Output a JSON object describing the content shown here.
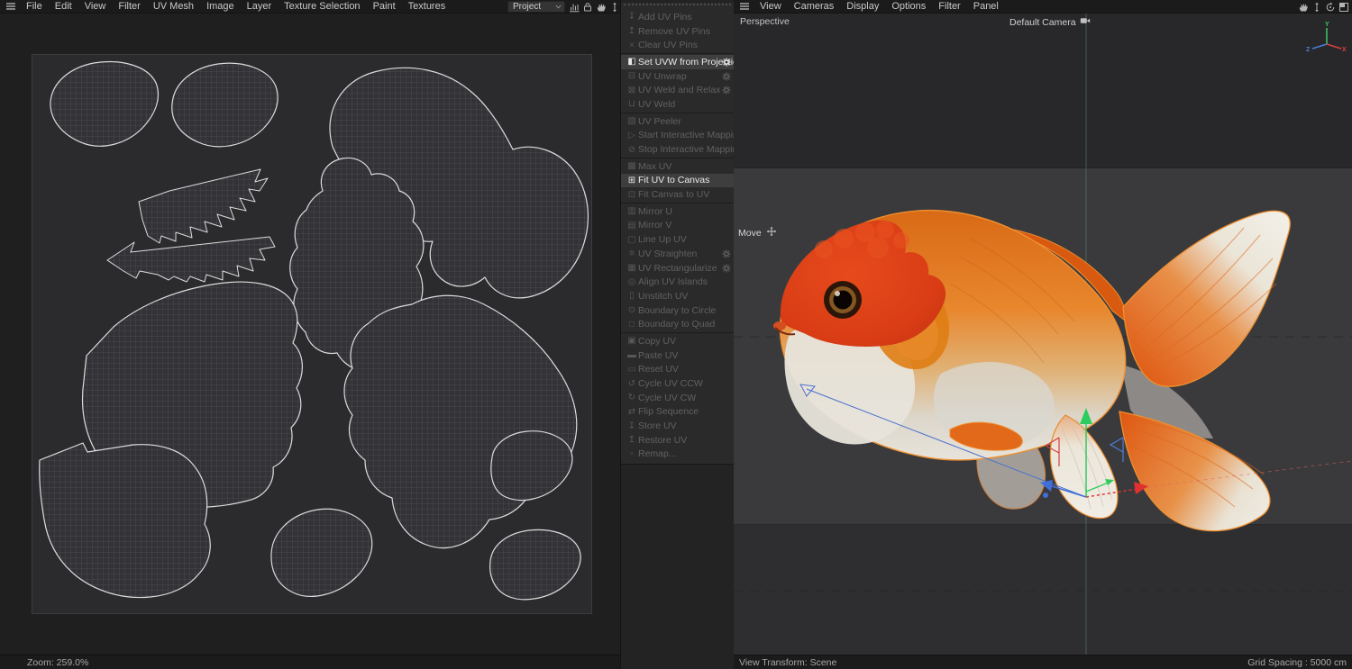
{
  "left_menubar": {
    "menu_items": [
      "File",
      "Edit",
      "View",
      "Filter",
      "UV Mesh",
      "Image",
      "Layer",
      "Texture Selection",
      "Paint",
      "Textures"
    ],
    "project_dropdown": {
      "value": "Project"
    },
    "toolbar_icons": [
      "histogram-icon",
      "lock-icon",
      "hand-icon",
      "pan-vertical-icon"
    ]
  },
  "right_menubar": {
    "menu_items": [
      "View",
      "Cameras",
      "Display",
      "Options",
      "Filter",
      "Panel"
    ],
    "nav_icons": [
      "hand-icon",
      "pan-vertical-icon",
      "rotate-icon",
      "maximize-icon"
    ]
  },
  "uv_panel": {
    "groups": [
      {
        "items": [
          {
            "label": "Add UV Pins",
            "icon": "pin-add-icon",
            "enabled": false
          },
          {
            "label": "Remove UV Pins",
            "icon": "pin-remove-icon",
            "enabled": false
          },
          {
            "label": "Clear UV Pins",
            "icon": "clear-icon",
            "enabled": false
          }
        ]
      },
      {
        "items": [
          {
            "label": "Set UVW from Projection",
            "icon": "set-uvw-icon",
            "enabled": true,
            "gear": true,
            "gear_bright": true
          },
          {
            "label": "UV Unwrap",
            "icon": "unwrap-icon",
            "enabled": false,
            "gear": true
          },
          {
            "label": "UV Weld and Relax",
            "icon": "weld-relax-icon",
            "enabled": false,
            "gear": true
          },
          {
            "label": "UV Weld",
            "icon": "weld-icon",
            "enabled": false
          }
        ]
      },
      {
        "items": [
          {
            "label": "UV Peeler",
            "icon": "peeler-icon",
            "enabled": false
          },
          {
            "label": "Start Interactive Mapping",
            "icon": "play-icon",
            "enabled": false
          },
          {
            "label": "Stop Interactive Mapping",
            "icon": "stop-icon",
            "enabled": false
          }
        ]
      },
      {
        "items": [
          {
            "label": "Max UV",
            "icon": "max-uv-icon",
            "enabled": false
          },
          {
            "label": "Fit UV to Canvas",
            "icon": "fit-uv-icon",
            "enabled": true
          },
          {
            "label": "Fit Canvas to UV",
            "icon": "fit-canvas-icon",
            "enabled": false
          }
        ]
      },
      {
        "items": [
          {
            "label": "Mirror U",
            "icon": "mirror-u-icon",
            "enabled": false
          },
          {
            "label": "Mirror V",
            "icon": "mirror-v-icon",
            "enabled": false
          },
          {
            "label": "Line Up UV",
            "icon": "line-up-icon",
            "enabled": false
          },
          {
            "label": "UV Straighten",
            "icon": "straighten-icon",
            "enabled": false,
            "gear": true
          },
          {
            "label": "UV Rectangularize",
            "icon": "rectangularize-icon",
            "enabled": false,
            "gear": true
          },
          {
            "label": "Align UV Islands",
            "icon": "align-icon",
            "enabled": false
          },
          {
            "label": "Unstitch UV",
            "icon": "unstitch-icon",
            "enabled": false
          },
          {
            "label": "Boundary to Circle",
            "icon": "boundary-circle-icon",
            "enabled": false
          },
          {
            "label": "Boundary to Quad",
            "icon": "boundary-quad-icon",
            "enabled": false
          }
        ]
      },
      {
        "items": [
          {
            "label": "Copy UV",
            "icon": "copy-icon",
            "enabled": false
          },
          {
            "label": "Paste UV",
            "icon": "paste-icon",
            "enabled": false
          },
          {
            "label": "Reset UV",
            "icon": "reset-icon",
            "enabled": false
          },
          {
            "label": "Cycle UV CCW",
            "icon": "cycle-ccw-icon",
            "enabled": false
          },
          {
            "label": "Cycle UV CW",
            "icon": "cycle-cw-icon",
            "enabled": false
          },
          {
            "label": "Flip Sequence",
            "icon": "flip-icon",
            "enabled": false
          },
          {
            "label": "Store UV",
            "icon": "store-icon",
            "enabled": false
          },
          {
            "label": "Restore UV",
            "icon": "restore-icon",
            "enabled": false
          },
          {
            "label": "Remap...",
            "icon": "remap-icon",
            "enabled": false
          }
        ]
      }
    ]
  },
  "uv_editor": {
    "zoom_status": "Zoom: 259.0%"
  },
  "viewport": {
    "view_mode": "Perspective",
    "camera": "Default Camera",
    "active_tool": "Move",
    "status_left": "View Transform: Scene",
    "status_right": "Grid Spacing : 5000 cm",
    "axis": {
      "x": "X",
      "y": "Y",
      "z": "Z"
    }
  },
  "colors": {
    "selection_outline": "#ef8f2f",
    "fish_orange": "#e2721f",
    "fish_red": "#d84418",
    "axis_x": "#d84040",
    "axis_y": "#3fc464",
    "axis_z": "#4a7fd6"
  }
}
